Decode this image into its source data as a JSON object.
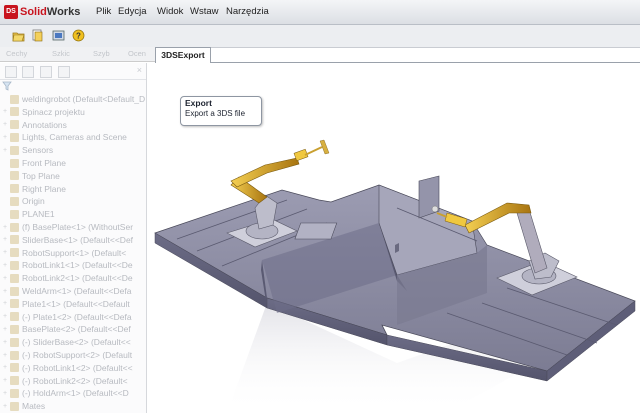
{
  "app": {
    "logo_ds": "DS",
    "logo_solid": "Solid",
    "logo_works": "Works"
  },
  "menu": [
    "Plik",
    "Edycja",
    "Widok",
    "Wstaw",
    "Narzędzia"
  ],
  "toolbar_icons": [
    "open-icon",
    "options-icon",
    "rebuild-icon",
    "help-icon"
  ],
  "command_tabs": [
    "Cechy",
    "Szkic",
    "Szyb",
    "Ocen"
  ],
  "active_tab": "3DSExport",
  "tooltip": {
    "title": "Export",
    "description": "Export a 3DS file"
  },
  "feature_tree": {
    "filter_icon": "filter-icon",
    "items": [
      {
        "label": "weldingrobot  (Default<Default_D",
        "exp": false
      },
      {
        "label": "Spinacz projektu",
        "exp": true
      },
      {
        "label": "Annotations",
        "exp": true
      },
      {
        "label": "Lights, Cameras and Scene",
        "exp": true
      },
      {
        "label": "Sensors",
        "exp": true
      },
      {
        "label": "Front Plane",
        "exp": false
      },
      {
        "label": "Top Plane",
        "exp": false
      },
      {
        "label": "Right Plane",
        "exp": false
      },
      {
        "label": "Origin",
        "exp": false
      },
      {
        "label": "PLANE1",
        "exp": false
      },
      {
        "label": "(f) BasePlate<1> (WithoutSer",
        "exp": true
      },
      {
        "label": "SliderBase<1> (Default<<Def",
        "exp": true
      },
      {
        "label": "RobotSupport<1> (Default<",
        "exp": true
      },
      {
        "label": "RobotLink1<1> (Default<<De",
        "exp": true
      },
      {
        "label": "RobotLink2<1> (Default<<De",
        "exp": true
      },
      {
        "label": "WeldArm<1> (Default<<Defa",
        "exp": true
      },
      {
        "label": "Plate1<1> (Default<<Default",
        "exp": true
      },
      {
        "label": "(-) Plate1<2> (Default<<Defa",
        "exp": true
      },
      {
        "label": "BasePlate<2> (Default<<Def",
        "exp": true
      },
      {
        "label": "(-) SliderBase<2> (Default<<",
        "exp": true
      },
      {
        "label": "(-) RobotSupport<2> (Default",
        "exp": true
      },
      {
        "label": "(-) RobotLink1<2> (Default<<",
        "exp": true
      },
      {
        "label": "(-) RobotLink2<2> (Default<",
        "exp": true
      },
      {
        "label": "(-) HoldArm<1> (Default<<D",
        "exp": true
      },
      {
        "label": "Mates",
        "exp": true
      }
    ]
  },
  "colors": {
    "accent": "#c8141e",
    "plate": "#8f8fa6",
    "robot": "#d8a020",
    "link": "#b7b3bf"
  }
}
